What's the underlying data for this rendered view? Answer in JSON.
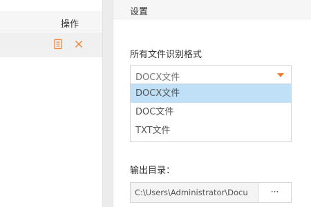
{
  "file_list": {
    "action_column_label": "操作",
    "row_actions": [
      {
        "name": "view",
        "icon": "document-icon",
        "color": "#f08030"
      },
      {
        "name": "delete",
        "icon": "close-icon",
        "color": "#f08030"
      }
    ]
  },
  "settings": {
    "title": "设置",
    "format_label": "所有文件识别格式",
    "format_select": {
      "value": "DOCX文件",
      "options": [
        "DOCX文件",
        "DOC文件",
        "TXT文件"
      ],
      "highlighted": "DOCX文件"
    },
    "output_label": "输出目录：",
    "output_path": "C:\\Users\\Administrator\\Docu",
    "browse_label": "···"
  },
  "colors": {
    "accent": "#f08030",
    "option_highlight": "#bfe0f7"
  }
}
